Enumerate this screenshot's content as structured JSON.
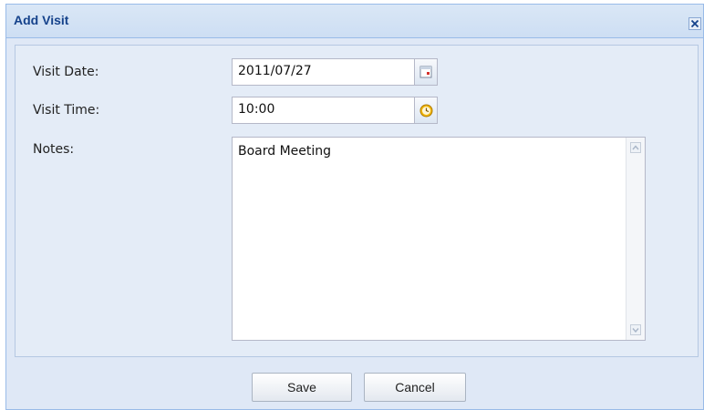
{
  "window": {
    "title": "Add Visit",
    "close_icon": "close-icon"
  },
  "form": {
    "visit_date": {
      "label": "Visit Date:",
      "value": "2011/07/27",
      "trigger_icon": "calendar-icon"
    },
    "visit_time": {
      "label": "Visit Time:",
      "value": "10:00",
      "trigger_icon": "clock-icon"
    },
    "notes": {
      "label": "Notes:",
      "value": "Board Meeting"
    }
  },
  "buttons": {
    "save_label": "Save",
    "cancel_label": "Cancel"
  },
  "colors": {
    "title_text": "#15428b",
    "panel_bg": "#dfe8f6",
    "border": "#99bbe8",
    "clock_accent": "#e8a700"
  }
}
